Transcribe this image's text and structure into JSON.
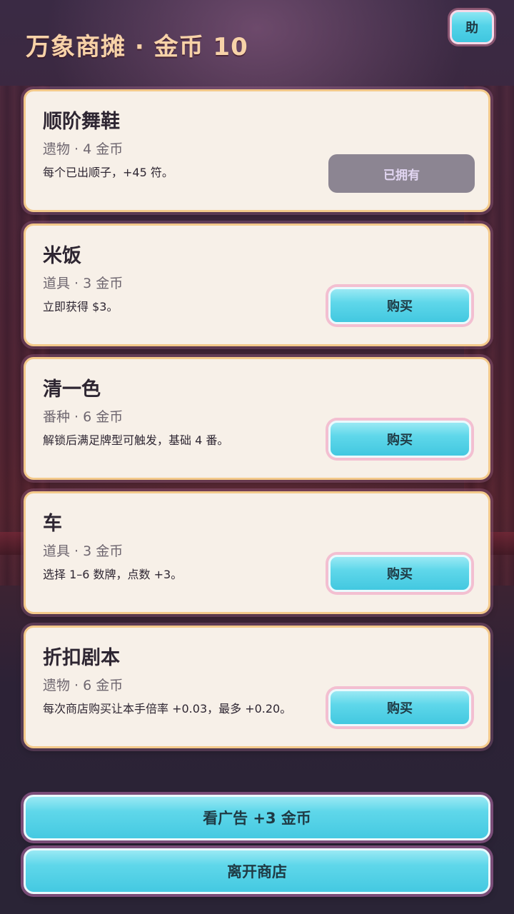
{
  "header": {
    "title": "万象商摊 · 金币 10",
    "help_label": "助"
  },
  "items": [
    {
      "name": "顺阶舞鞋",
      "meta": "遗物 · 4 金币",
      "desc": "每个已出顺子，+45 符。",
      "button": "已拥有",
      "owned": true
    },
    {
      "name": "米饭",
      "meta": "道具 · 3 金币",
      "desc": "立即获得 $3。",
      "button": "购买",
      "owned": false
    },
    {
      "name": "清一色",
      "meta": "番种 · 6 金币",
      "desc": "解锁后满足牌型可触发，基础 4 番。",
      "button": "购买",
      "owned": false
    },
    {
      "name": "车",
      "meta": "道具 · 3 金币",
      "desc": "选择 1–6 数牌，点数 +3。",
      "button": "购买",
      "owned": false
    },
    {
      "name": "折扣剧本",
      "meta": "遗物 · 6 金币",
      "desc": "每次商店购买让本手倍率 +0.03，最多 +0.20。",
      "button": "购买",
      "owned": false
    }
  ],
  "footer": {
    "ad_label": "看广告 +3 金币",
    "leave_label": "离开商店"
  }
}
